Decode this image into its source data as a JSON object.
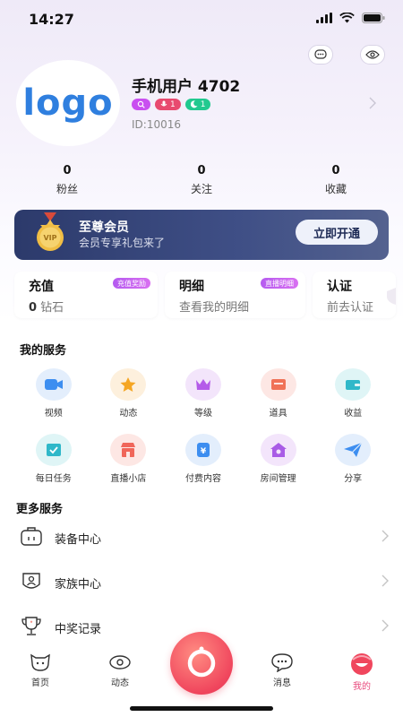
{
  "status": {
    "time": "14:27"
  },
  "profile": {
    "avatar_text": "logo",
    "name": "手机用户 4702",
    "id": "ID:10016",
    "badges": [
      {
        "text": "",
        "color": "#c94ff0"
      },
      {
        "text": "1",
        "color": "#e84a6f"
      },
      {
        "text": "1",
        "color": "#22c98f"
      }
    ]
  },
  "stats": [
    {
      "value": "0",
      "label": "粉丝"
    },
    {
      "value": "0",
      "label": "关注"
    },
    {
      "value": "0",
      "label": "收藏"
    }
  ],
  "vip": {
    "title": "至尊会员",
    "subtitle": "会员专享礼包来了",
    "button": "立即开通",
    "medal_text": "VIP"
  },
  "cards": [
    {
      "title": "充值",
      "value": "0",
      "unit": " 钻石",
      "tag": "充值奖励"
    },
    {
      "title": "明细",
      "sub": "查看我的明细",
      "tag": "直播明细"
    },
    {
      "title": "认证",
      "sub": "前去认证"
    }
  ],
  "services": {
    "title": "我的服务",
    "items": [
      {
        "label": "视频",
        "icon": "video-icon",
        "bg": "#e3eefc",
        "fg": "#3d8ef0"
      },
      {
        "label": "动态",
        "icon": "star-icon",
        "bg": "#fdf0dd",
        "fg": "#f5a623"
      },
      {
        "label": "等级",
        "icon": "crown-icon",
        "bg": "#f3e5fb",
        "fg": "#b45be9"
      },
      {
        "label": "道具",
        "icon": "box-icon",
        "bg": "#fde7e4",
        "fg": "#f07257"
      },
      {
        "label": "收益",
        "icon": "wallet-icon",
        "bg": "#dff5f6",
        "fg": "#2fb8c9"
      },
      {
        "label": "每日任务",
        "icon": "tasks-icon",
        "bg": "#dff5f6",
        "fg": "#2fb8c9"
      },
      {
        "label": "直播小店",
        "icon": "shop-icon",
        "bg": "#fde7e4",
        "fg": "#f0665a"
      },
      {
        "label": "付费内容",
        "icon": "paid-content-icon",
        "bg": "#e3eefc",
        "fg": "#3d8ef0"
      },
      {
        "label": "房间管理",
        "icon": "room-icon",
        "bg": "#f3e5fb",
        "fg": "#a95ce6"
      },
      {
        "label": "分享",
        "icon": "share-icon",
        "bg": "#e3eefc",
        "fg": "#3d8ef0"
      }
    ]
  },
  "more": {
    "title": "更多服务",
    "items": [
      {
        "label": "装备中心",
        "icon": "equipment-icon"
      },
      {
        "label": "家族中心",
        "icon": "family-icon"
      },
      {
        "label": "中奖记录",
        "icon": "trophy-icon"
      }
    ]
  },
  "tabs": [
    {
      "label": "首页",
      "icon": "home-icon"
    },
    {
      "label": "动态",
      "icon": "moments-icon"
    },
    {
      "label": "消息",
      "icon": "message-icon"
    },
    {
      "label": "我的",
      "icon": "me-icon",
      "active": true
    }
  ],
  "colors": {
    "accent": "#e84a7d",
    "vip_bg": "#2c3a6b",
    "tag": "#c45ff0"
  }
}
